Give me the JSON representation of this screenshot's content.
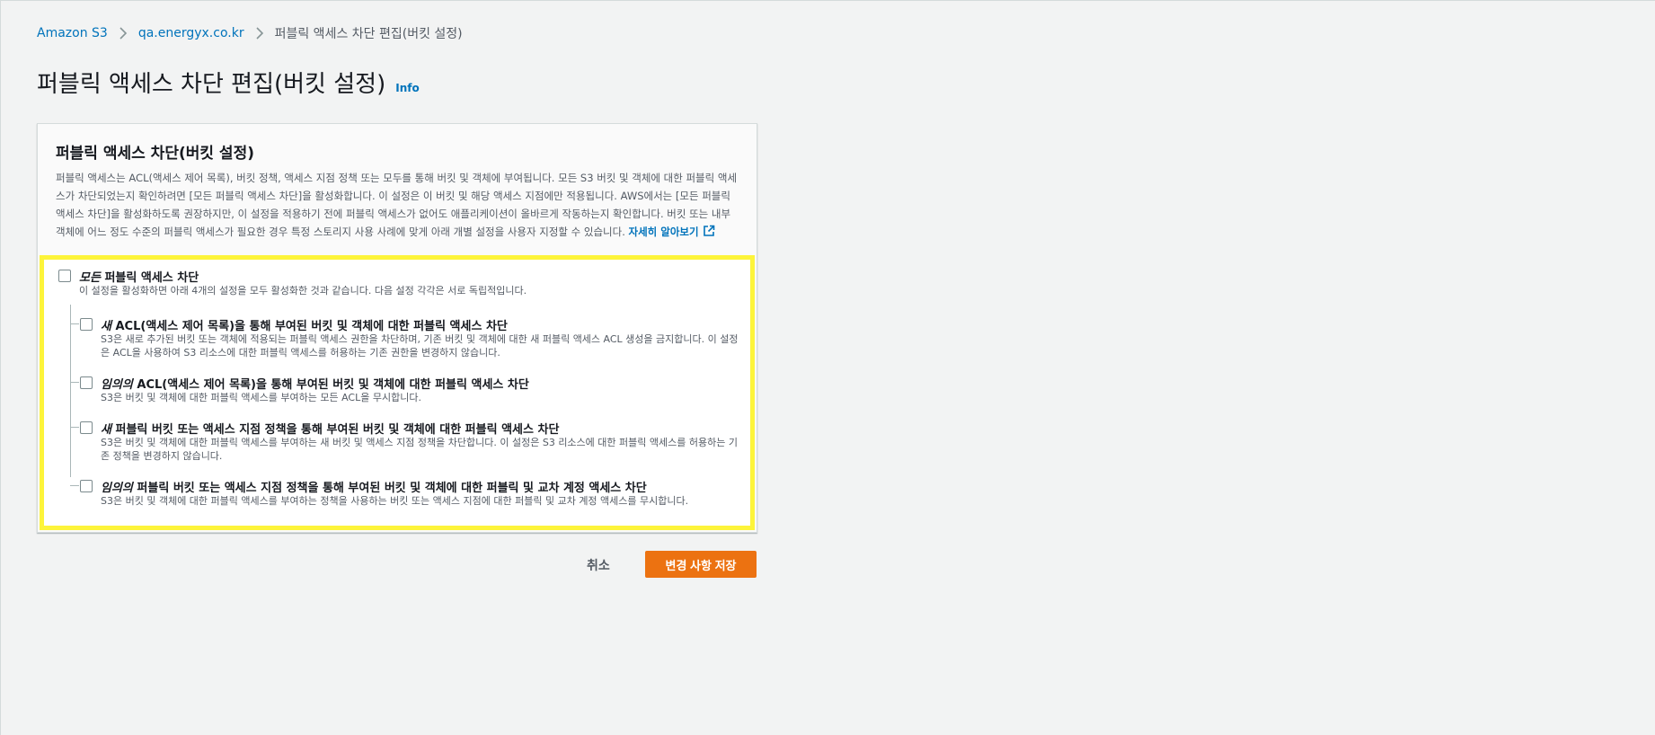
{
  "breadcrumb": {
    "items": [
      {
        "label": "Amazon S3"
      },
      {
        "label": "qa.energyx.co.kr"
      },
      {
        "label": "퍼블릭 액세스 차단 편집(버킷 설정)"
      }
    ]
  },
  "header": {
    "title": "퍼블릭 액세스 차단 편집(버킷 설정)",
    "info_label": "Info"
  },
  "panel": {
    "title": "퍼블릭 액세스 차단(버킷 설정)",
    "description": "퍼블릭 액세스는 ACL(액세스 제어 목록), 버킷 정책, 액세스 지점 정책 또는 모두를 통해 버킷 및 객체에 부여됩니다. 모든 S3 버킷 및 객체에 대한 퍼블릭 액세스가 차단되었는지 확인하려면 [모든 퍼블릭 액세스 차단]을 활성화합니다. 이 설정은 이 버킷 및 해당 액세스 지점에만 적용됩니다. AWS에서는 [모든 퍼블릭 액세스 차단]을 활성화하도록 권장하지만, 이 설정을 적용하기 전에 퍼블릭 액세스가 없어도 애플리케이션이 올바르게 작동하는지 확인합니다. 버킷 또는 내부 객체에 어느 정도 수준의 퍼블릭 액세스가 필요한 경우 특정 스토리지 사용 사례에 맞게 아래 개별 설정을 사용자 지정할 수 있습니다.",
    "learn_more": "자세히 알아보기"
  },
  "settings": {
    "block_all": {
      "title_em": "모든",
      "title_rest": " 퍼블릭 액세스 차단",
      "description": "이 설정을 활성화하면 아래 4개의 설정을 모두 활성화한 것과 같습니다. 다음 설정 각각은 서로 독립적입니다.",
      "checked": false
    },
    "options": [
      {
        "title_em": "새",
        "title_rest": " ACL(액세스 제어 목록)을 통해 부여된 버킷 및 객체에 대한 퍼블릭 액세스 차단",
        "description": "S3은 새로 추가된 버킷 또는 객체에 적용되는 퍼블릭 액세스 권한을 차단하며, 기존 버킷 및 객체에 대한 새 퍼블릭 액세스 ACL 생성을 금지합니다. 이 설정은 ACL을 사용하여 S3 리소스에 대한 퍼블릭 액세스를 허용하는 기존 권한을 변경하지 않습니다.",
        "checked": false
      },
      {
        "title_em": "임의의",
        "title_rest": " ACL(액세스 제어 목록)을 통해 부여된 버킷 및 객체에 대한 퍼블릭 액세스 차단",
        "description": "S3은 버킷 및 객체에 대한 퍼블릭 액세스를 부여하는 모든 ACL을 무시합니다.",
        "checked": false
      },
      {
        "title_em": "새",
        "title_rest": " 퍼블릭 버킷 또는 액세스 지점 정책을 통해 부여된 버킷 및 객체에 대한 퍼블릭 액세스 차단",
        "description": "S3은 버킷 및 객체에 대한 퍼블릭 액세스를 부여하는 새 버킷 및 액세스 지점 정책을 차단합니다. 이 설정은 S3 리소스에 대한 퍼블릭 액세스를 허용하는 기존 정책을 변경하지 않습니다.",
        "checked": false
      },
      {
        "title_em": "임의의",
        "title_rest": " 퍼블릭 버킷 또는 액세스 지점 정책을 통해 부여된 버킷 및 객체에 대한 퍼블릭 및 교차 계정 액세스 차단",
        "description": "S3은 버킷 및 객체에 대한 퍼블릭 액세스를 부여하는 정책을 사용하는 버킷 또는 액세스 지점에 대한 퍼블릭 및 교차 계정 액세스를 무시합니다.",
        "checked": false
      }
    ]
  },
  "actions": {
    "cancel_label": "취소",
    "save_label": "변경 사항 저장"
  },
  "colors": {
    "link": "#0073bb",
    "primary_button": "#ec7211",
    "highlight_border": "#fdf43a",
    "background": "#f2f3f3"
  }
}
